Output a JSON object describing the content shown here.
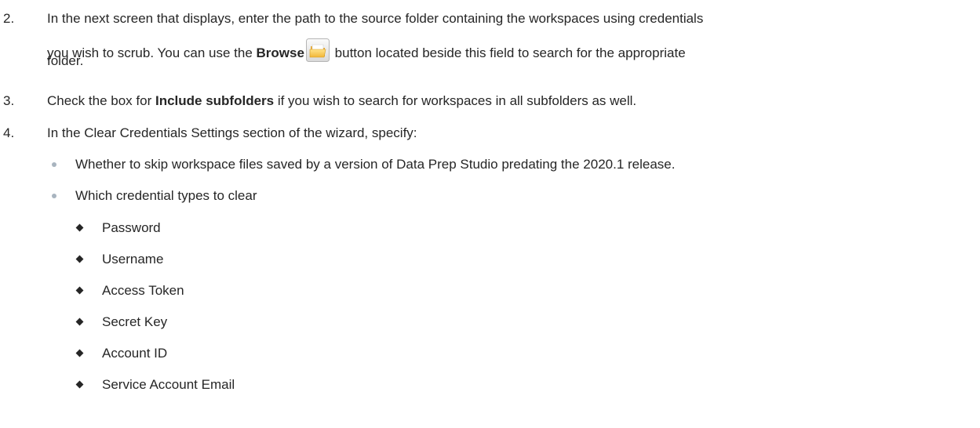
{
  "steps": [
    {
      "number": "2.",
      "line1": "In the next screen that displays, enter the path to the source folder containing the workspaces using credentials",
      "line2_before": "you wish to scrub. You can use the ",
      "line2_bold": "Browse",
      "line2_after": " button located beside this field to search for the appropriate",
      "line3": "folder.",
      "icon": "open-folder-icon"
    },
    {
      "number": "3.",
      "before": "Check the box for ",
      "bold": "Include subfolders",
      "after": " if you wish to search for workspaces in all subfolders as well."
    },
    {
      "number": "4.",
      "text": "In the Clear Credentials Settings section of the wizard, specify:",
      "bullets": [
        "Whether to skip workspace files saved by a version of Data Prep Studio predating the 2020.1 release.",
        "Which credential types to clear"
      ],
      "credential_types": [
        "Password",
        "Username",
        "Access Token",
        "Secret Key",
        "Account ID",
        "Service Account Email"
      ]
    }
  ]
}
